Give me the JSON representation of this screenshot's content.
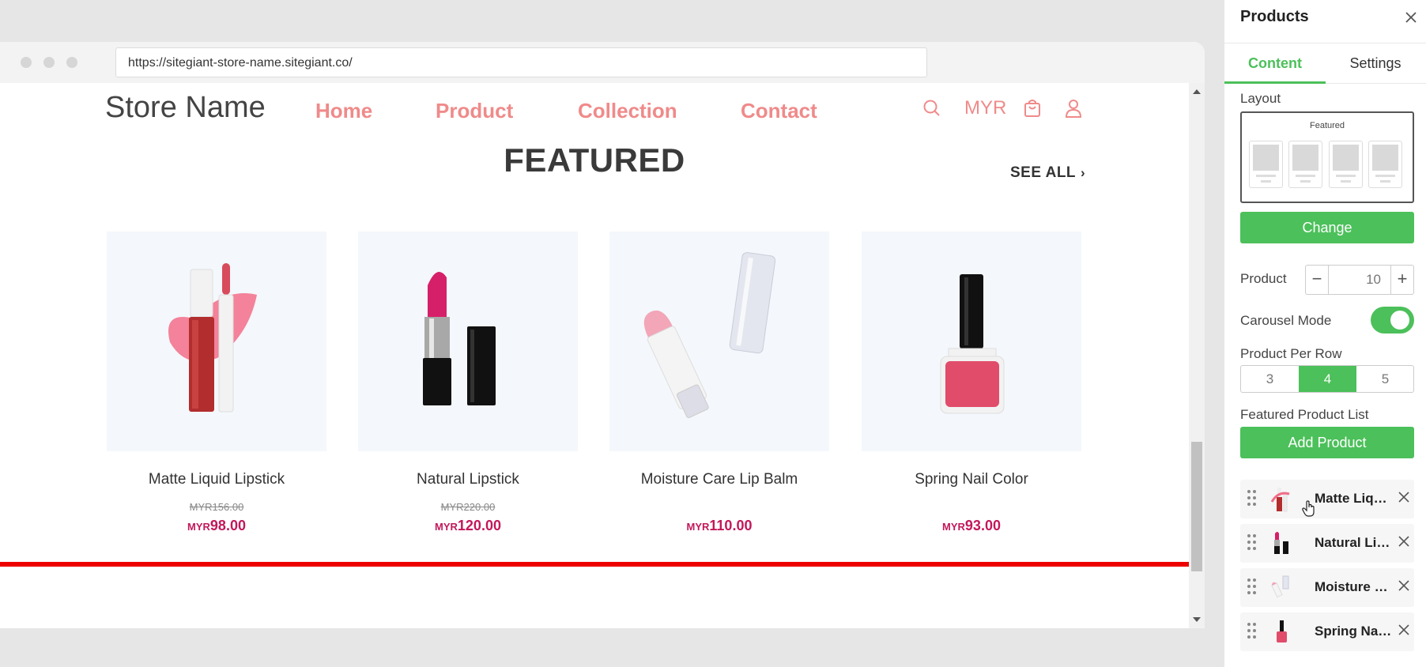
{
  "browser": {
    "url": "https://sitegiant-store-name.sitegiant.co/"
  },
  "store": {
    "name": "Store Name",
    "nav": [
      "Home",
      "Product",
      "Collection",
      "Contact"
    ],
    "currency": "MYR",
    "icons": [
      "search-icon",
      "cart-icon",
      "user-icon"
    ]
  },
  "section": {
    "title": "FEATURED",
    "see_all": "SEE ALL"
  },
  "products": [
    {
      "name": "Matte Liquid Lipstick",
      "old_price": "MYR156.00",
      "currency": "MYR",
      "price": "98.00"
    },
    {
      "name": "Natural Lipstick",
      "old_price": "MYR220.00",
      "currency": "MYR",
      "price": "120.00"
    },
    {
      "name": "Moisture Care Lip Balm",
      "old_price": "",
      "currency": "MYR",
      "price": "110.00"
    },
    {
      "name": "Spring Nail Color",
      "old_price": "",
      "currency": "MYR",
      "price": "93.00"
    }
  ],
  "panel": {
    "title": "Products",
    "tabs": [
      "Content",
      "Settings"
    ],
    "active_tab": "Content",
    "layout_label": "Layout",
    "layout_preview_title": "Featured",
    "change_label": "Change",
    "product_label": "Product",
    "product_count": "10",
    "carousel_label": "Carousel Mode",
    "carousel_on": true,
    "per_row_label": "Product Per Row",
    "per_row_options": [
      "3",
      "4",
      "5"
    ],
    "per_row_selected": "4",
    "featured_list_label": "Featured Product List",
    "add_product_label": "Add Product",
    "featured_items": [
      "Matte Liquid Lipstick",
      "Natural Lipstick",
      "Moisture Care Lip Balm",
      "Spring Nail Color"
    ]
  },
  "colors": {
    "accent_green": "#4cc05a",
    "nav_pink": "#f08a8a",
    "price_magenta": "#c2185b",
    "divider_red": "#ee0000"
  }
}
